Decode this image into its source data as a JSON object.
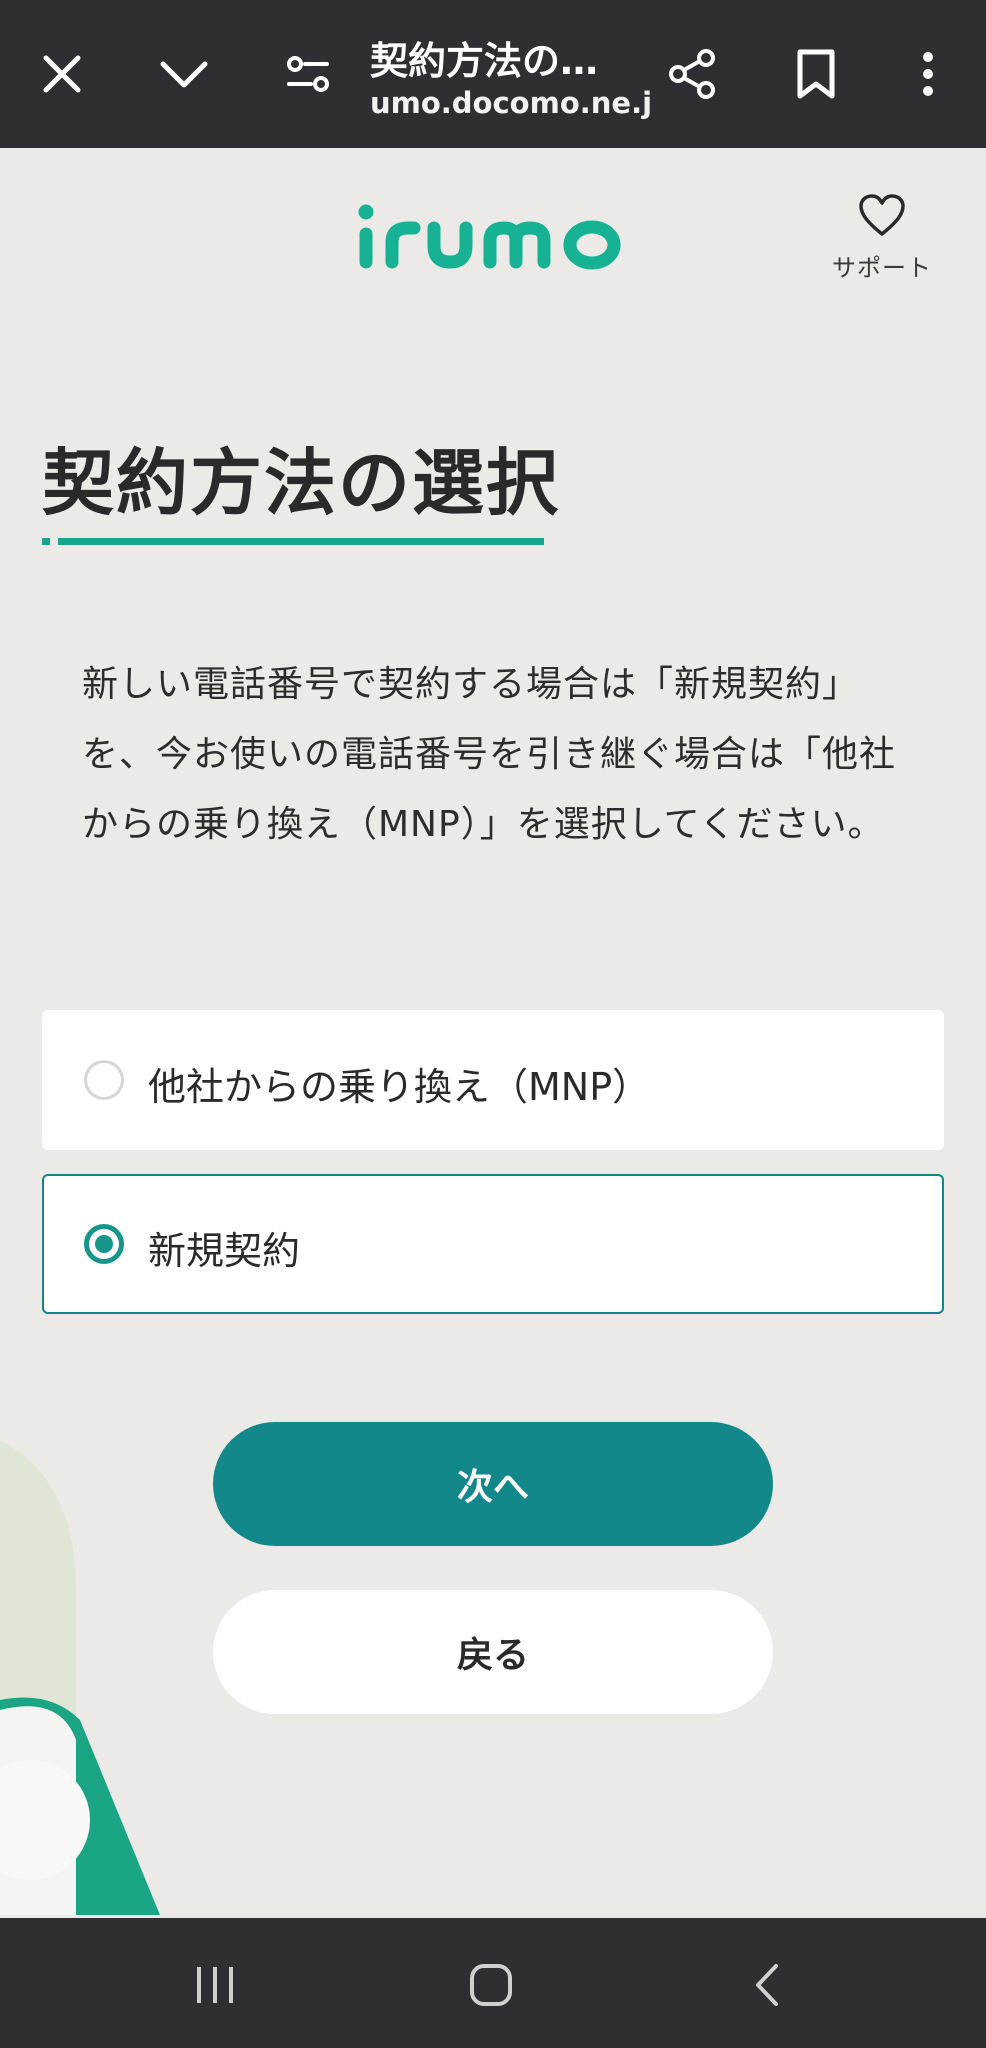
{
  "browser": {
    "title": "契約方法の…",
    "url": "umo.docomo.ne.jp",
    "icons": [
      "close-icon",
      "chevron-down-icon",
      "site-settings-icon",
      "share-icon",
      "bookmark-icon",
      "more-vert-icon"
    ]
  },
  "header": {
    "logo_text": "irumo",
    "support_label": "サポート"
  },
  "page": {
    "title": "契約方法の選択",
    "description": "新しい電話番号で契約する場合は「新規契約」を、今お使いの電話番号を引き継ぐ場合は「他社からの乗り換え（MNP）」を選択してください。"
  },
  "options": [
    {
      "label": "他社からの乗り換え（MNP）",
      "selected": false
    },
    {
      "label": "新規契約",
      "selected": true
    }
  ],
  "buttons": {
    "next_label": "次へ",
    "back_label": "戻る"
  },
  "colors": {
    "brand": "#16a58e",
    "primary_button": "#12888b",
    "background": "#ebeae7",
    "chrome": "#2d2f33"
  }
}
